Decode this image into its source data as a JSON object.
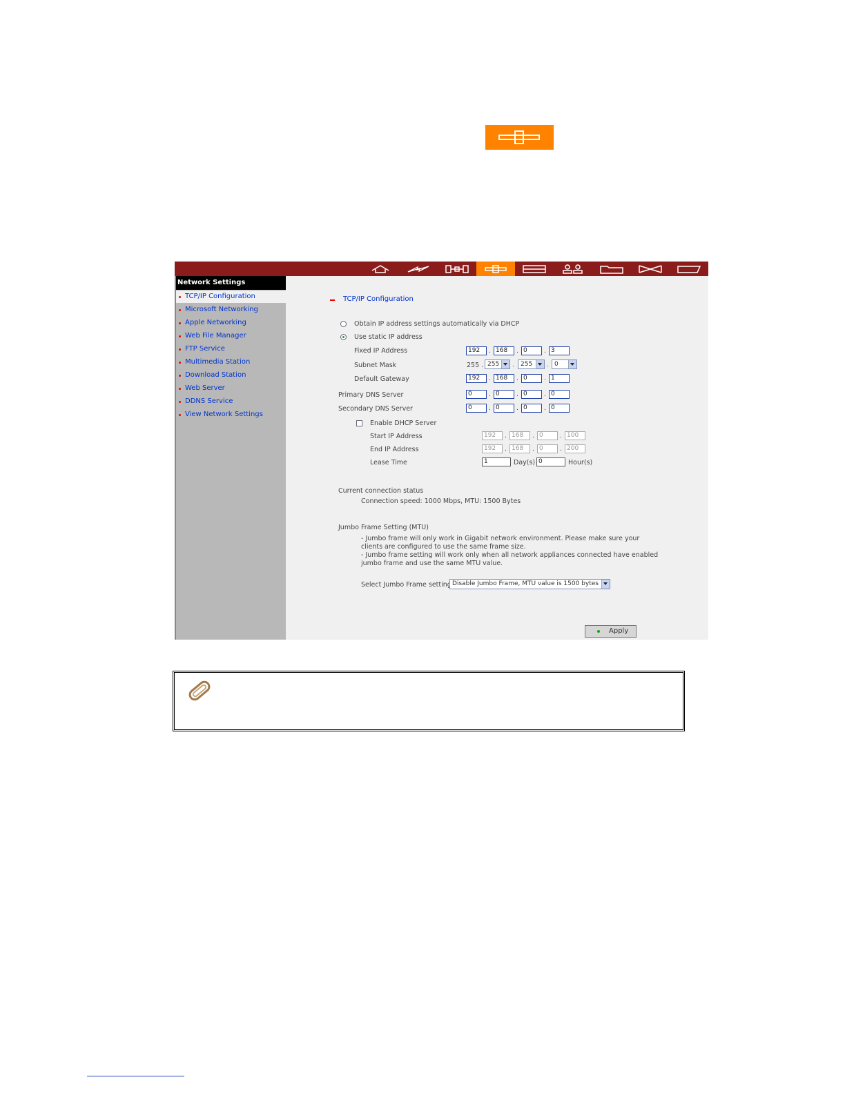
{
  "topbar": {
    "icons": [
      "home-icon",
      "lightning-icon",
      "disk-icon",
      "network-icon",
      "device-icon",
      "users-icon",
      "folder-icon",
      "hourglass-icon",
      "tag-icon"
    ],
    "active": "network-icon",
    "colors": {
      "bar": "#8b1c1c",
      "active": "#ff8200"
    }
  },
  "sidebar": {
    "title": "Network Settings",
    "items": [
      "TCP/IP Configuration",
      "Microsoft Networking",
      "Apple Networking",
      "Web File Manager",
      "FTP Service",
      "Multimedia Station",
      "Download Station",
      "Web Server",
      "DDNS Service",
      "View Network Settings"
    ]
  },
  "main": {
    "section_title": "TCP/IP Configuration",
    "dhcp_option": "Obtain IP address settings automatically via DHCP",
    "static_option": "Use static IP address",
    "fixed_ip_label": "Fixed IP Address",
    "fixed_ip": [
      "192",
      "168",
      "0",
      "3"
    ],
    "subnet_label": "Subnet Mask",
    "subnet_first": "255 .",
    "subnet": [
      "255",
      "255",
      "0"
    ],
    "gateway_label": "Default Gateway",
    "gateway": [
      "192",
      "168",
      "0",
      "1"
    ],
    "primary_dns_label": "Primary DNS Server",
    "primary_dns": [
      "0",
      "0",
      "0",
      "0"
    ],
    "secondary_dns_label": "Secondary DNS Server",
    "secondary_dns": [
      "0",
      "0",
      "0",
      "0"
    ],
    "enable_dhcp_label": "Enable DHCP Server",
    "start_ip_label": "Start IP Address",
    "start_ip": [
      "192",
      "168",
      "0",
      "100"
    ],
    "end_ip_label": "End IP Address",
    "end_ip": [
      "192",
      "168",
      "0",
      "200"
    ],
    "lease_label": "Lease Time",
    "lease_days": "1",
    "days_unit": "Day(s)",
    "lease_hours": "0",
    "hours_unit": "Hour(s)",
    "status_title": "Current connection status",
    "status_text": "Connection speed: 1000 Mbps, MTU: 1500 Bytes",
    "jumbo_title": "Jumbo Frame Setting (MTU)",
    "jumbo_notes": [
      "- Jumbo frame will only work in Gigabit network environment. Please make sure your",
      "clients are configured to use the same frame size.",
      "- Jumbo frame setting will work only when all network appliances connected have enabled",
      "jumbo frame and use the same MTU value."
    ],
    "jumbo_select_label": "Select Jumbo Frame setting:",
    "jumbo_select_value": "Disable Jumbo Frame, MTU value is 1500 bytes",
    "apply_label": "Apply"
  },
  "note_icon": "paperclip-icon"
}
